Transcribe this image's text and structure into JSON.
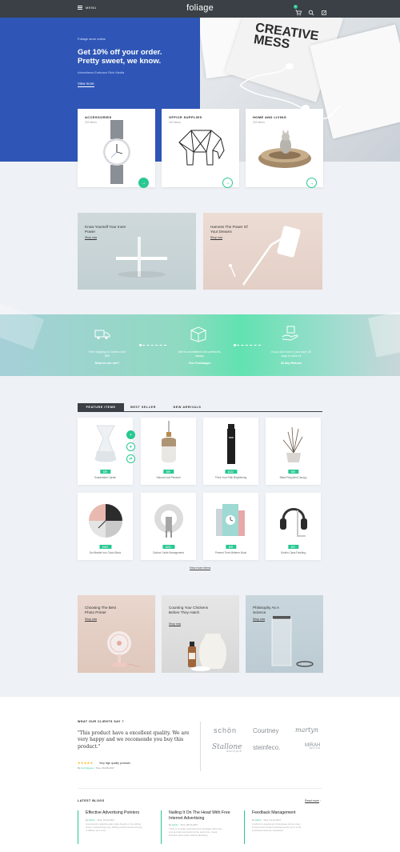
{
  "header": {
    "menu_label": "MENU",
    "logo": "foliage",
    "cart_count": "0",
    "icons": [
      "cart-icon",
      "search-icon",
      "user-icon"
    ]
  },
  "hero": {
    "small": "Foliage store online",
    "title": "Get 10% off your order. Pretty sweet, we know.",
    "subtitle": "Advertisers Embrace Rich Media",
    "link": "View more",
    "book_text": "CREATIVE MESS"
  },
  "categories": [
    {
      "title": "ACCESSORIES",
      "sub": "320 Items"
    },
    {
      "title": "OFFICE SUPPLIES",
      "sub": "320 Items"
    },
    {
      "title": "HOME AND LIVING",
      "sub": "320 Items"
    }
  ],
  "promos": [
    {
      "title": "Know Yourself Your Inner Power",
      "link": "Shop now"
    },
    {
      "title": "Harness The Power Of Your Dreams",
      "link": "Shop now"
    }
  ],
  "features": [
    {
      "text": "Free shipping on Orders over $99",
      "link": "Read on our rule?"
    },
    {
      "text": "We're committed to the perfect fit, always",
      "link": "Free Exchanges"
    },
    {
      "text": "If you don't love it, you have 30 days to return it",
      "link": "30 Day Returns"
    }
  ],
  "tabs": [
    "FEATURE ITEMS",
    "BEST SELLER",
    "NEW ARRIVALS"
  ],
  "products": [
    {
      "price": "$99",
      "name": "Sustainable Carafe"
    },
    {
      "price": "$99",
      "name": "Sakura Leaf Pendant"
    },
    {
      "price": "$132",
      "name": "Think Your Path Brightening"
    },
    {
      "price": "$99",
      "name": "Blake Recycled Canopy"
    },
    {
      "price": "$302",
      "name": "Dot Marble Iron Clock Block"
    },
    {
      "price": "$222",
      "name": "Outbux Cable Management"
    },
    {
      "price": "$99",
      "name": "Present Time Midterm Book"
    },
    {
      "price": "$57",
      "name": "Scribin Class Padding"
    }
  ],
  "view_more": "View more items",
  "bottom_promos": [
    {
      "title": "Choosing The Best Photo Printer",
      "link": "Shop now"
    },
    {
      "title": "Counting Your Chickens Before They Hatch",
      "link": "Shop now"
    },
    {
      "title": "Philosophy As A Science",
      "link": "Shop now"
    }
  ],
  "testimonial": {
    "label": "WHAT OUR CLIENTS SAY ?",
    "quote": "\"This product have a excellent quality. We are very happy and we recomende you buy this product.\"",
    "stars": "★★★★★",
    "review": "Very high quality products",
    "by_prefix": "By",
    "author": "Anh Nguyen",
    "time": "Time: 09-08-2017"
  },
  "brands": [
    {
      "name": "schön",
      "sub": ""
    },
    {
      "name": "Courtney",
      "sub": ""
    },
    {
      "name": "martyn",
      "sub": ""
    },
    {
      "name": "Stallone",
      "sub": "BOUTIQUE"
    },
    {
      "name": "steinfeco.",
      "sub": ""
    },
    {
      "name": "MIRAH",
      "sub": "TEXTILE"
    }
  ],
  "blogs": {
    "label": "LATEST BLOGS",
    "read_more": "Read more",
    "items": [
      {
        "title": "Effective Advertising Pointers",
        "by": "By",
        "author": "Admin",
        "time": "Time: 01-16-2017",
        "excerpt": "A successful marketing plan relies heavily on the pulling power of advertising copy. Writing result-oriented ad copy is difficult, as it must"
      },
      {
        "title": "Nailing It On The Head With Free Internet Advertising",
        "by": "By",
        "author": "Admin",
        "time": "Time: 08-13-2017",
        "excerpt": "There is no better advertisement campaign that is low cost and also successful at the same time. Great business ideas when utilized effectively"
      },
      {
        "title": "Feedback Management",
        "by": "By",
        "author": "Admin",
        "time": "Time: 12-21-2017",
        "excerpt": "In efforts to expand any businesses, all too many Government Funded Industries tend to go it to the individual enrolment Operations"
      }
    ]
  },
  "colors": {
    "accent": "#28c891",
    "hero_blue": "#2f56b6",
    "dark": "#3a4045"
  }
}
